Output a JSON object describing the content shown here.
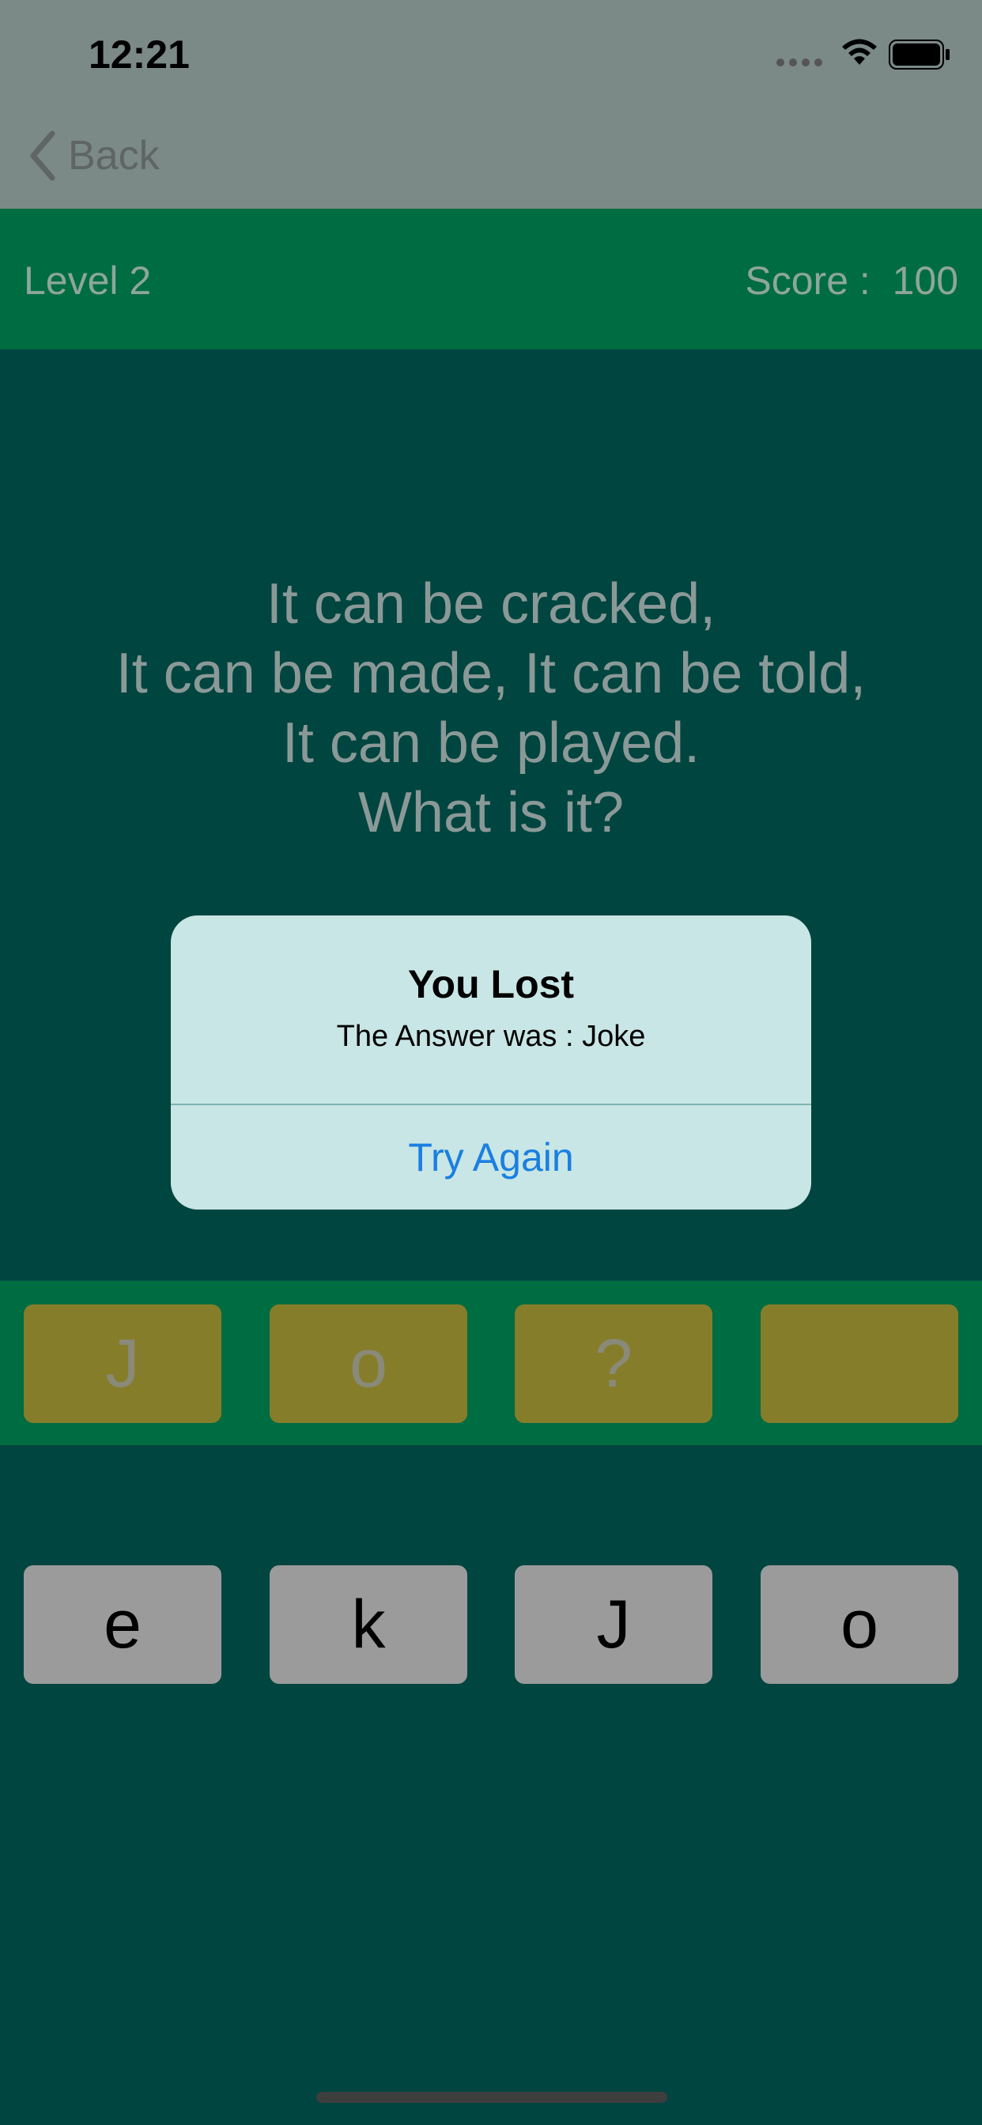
{
  "status_bar": {
    "time": "12:21"
  },
  "nav": {
    "back_label": "Back"
  },
  "header": {
    "level": "Level 2",
    "score": "Score :  100"
  },
  "riddle": {
    "lines": [
      "It can be cracked,",
      "It can be made, It can be told,",
      "It can be played.",
      "What is it?"
    ]
  },
  "answer_slots": [
    "J",
    "o",
    "?",
    ""
  ],
  "letter_keys": [
    "e",
    "k",
    "J",
    "o"
  ],
  "alert": {
    "title": "You Lost",
    "message": "The Answer was : Joke",
    "action_label": "Try Again"
  },
  "colors": {
    "background": "#004540",
    "header": "#006c42",
    "answer_slot": "#857d2a",
    "letter_key": "#9b9b9b",
    "alert_bg": "#c8e6e5",
    "link_blue": "#1a7fe0"
  }
}
